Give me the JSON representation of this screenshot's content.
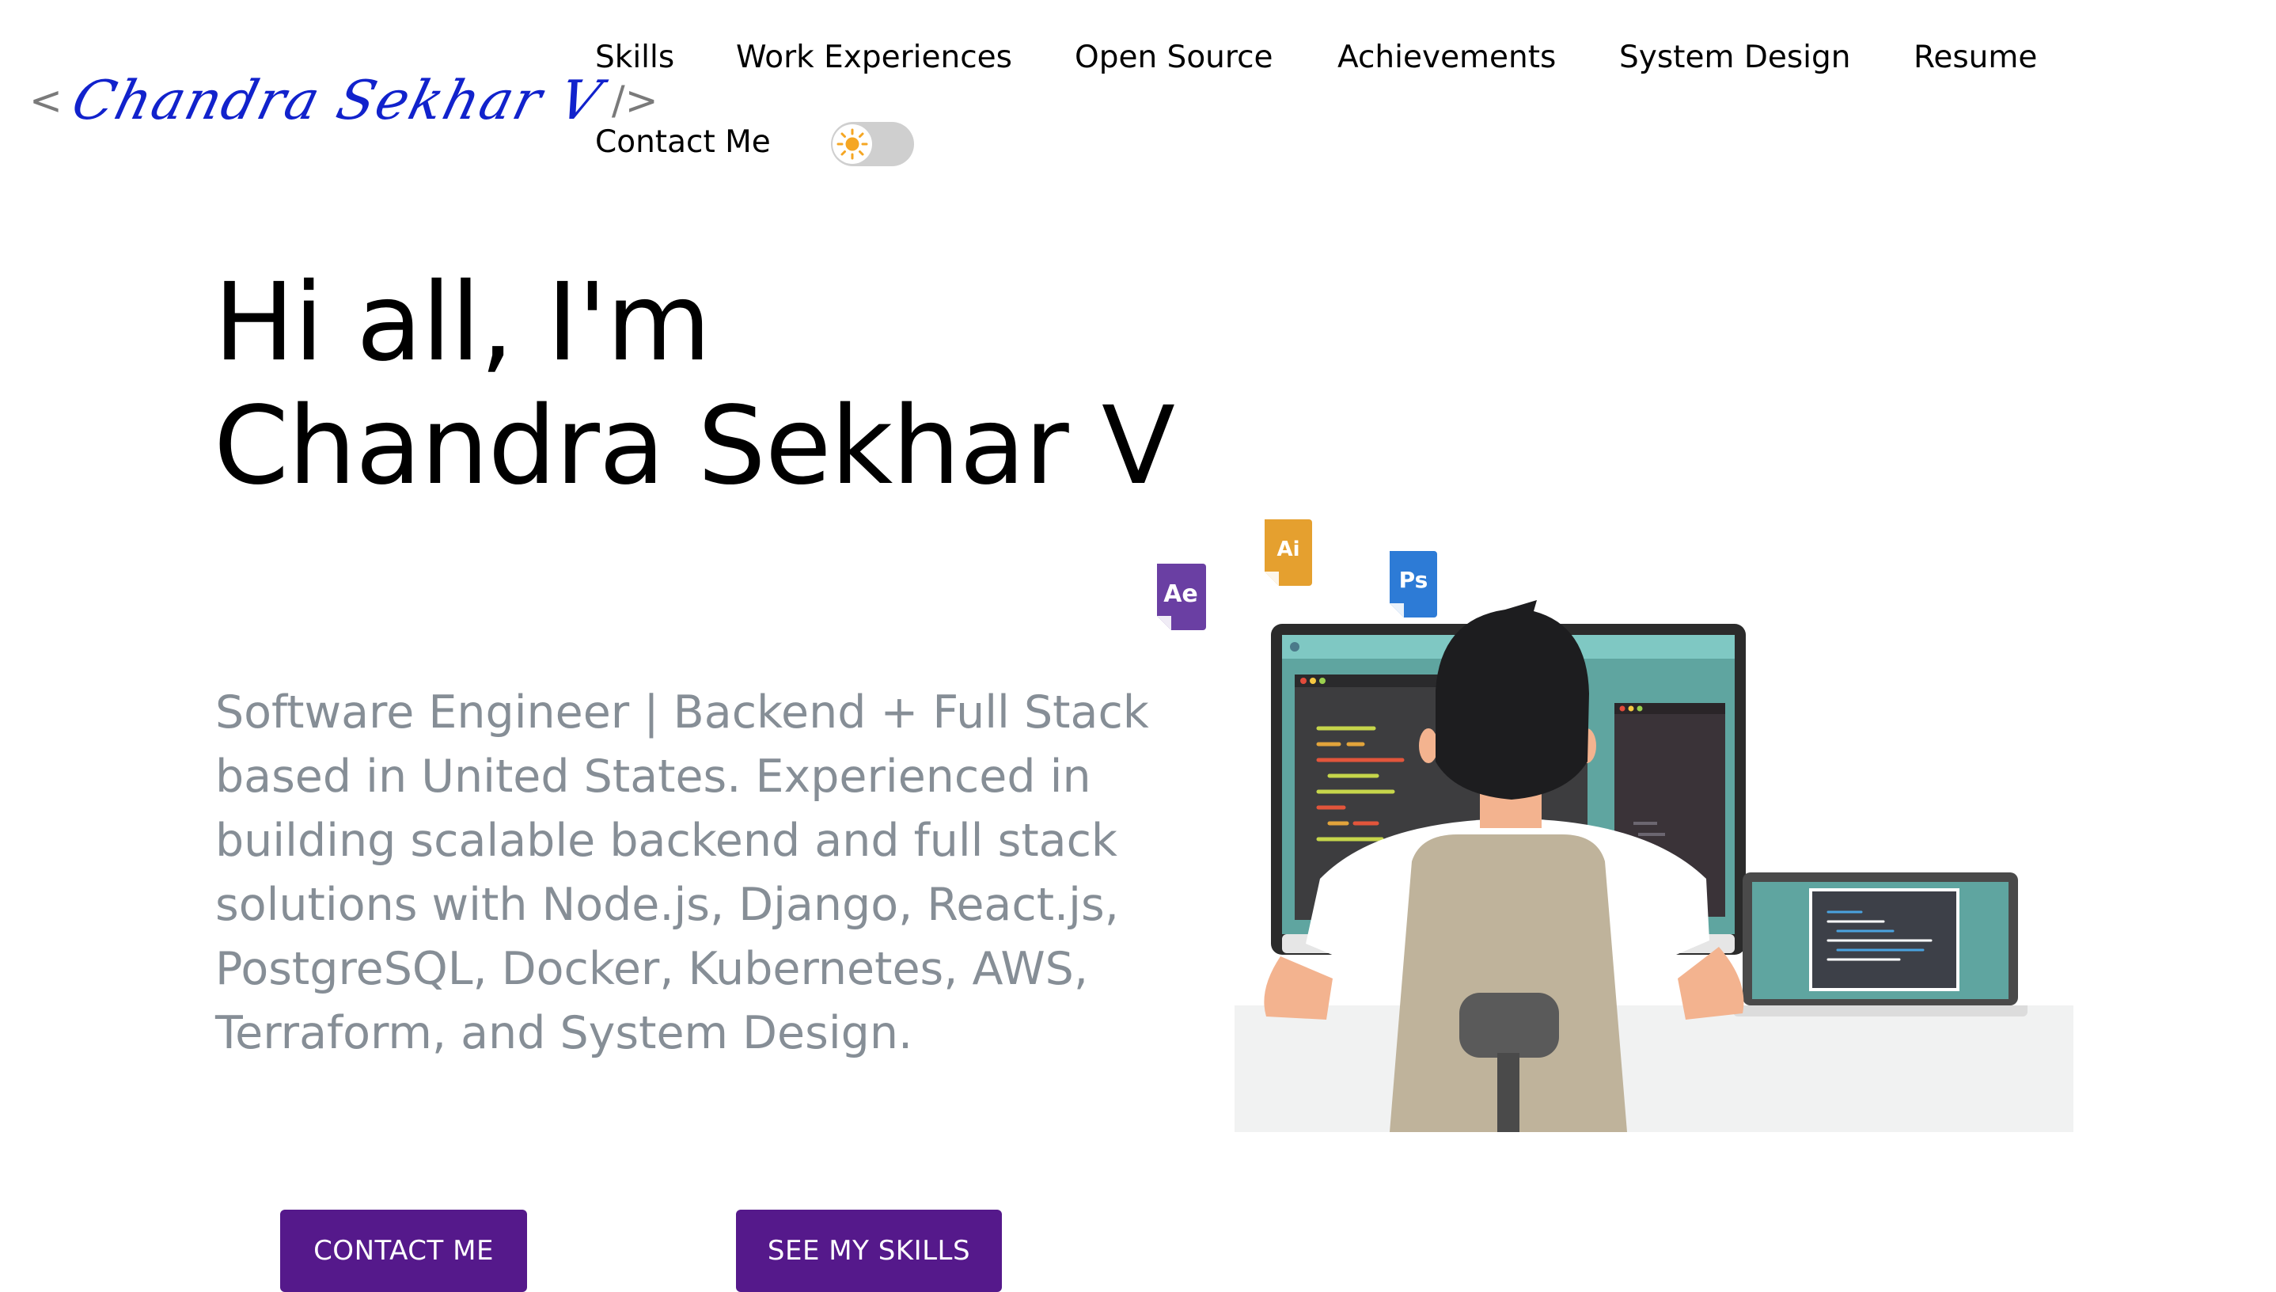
{
  "header": {
    "logo_open": "<",
    "logo_signature": "Chandra Sekhar V",
    "logo_close": "/>",
    "nav": [
      "Skills",
      "Work Experiences",
      "Open Source",
      "Achievements",
      "System Design",
      "Resume",
      "Contact Me"
    ],
    "theme_toggle_icon": "sun-icon"
  },
  "hero": {
    "greeting": "Hi all, I'm Chandra Sekhar V",
    "subtitle": "Software Engineer | Backend + Full Stack based in United States. Experienced in building scalable backend and full stack solutions with Node.js, Django, React.js, PostgreSQL, Docker, Kubernetes, AWS, Terraform, and System Design.",
    "contact_button": "CONTACT ME",
    "skills_button": "SEE MY SKILLS"
  },
  "illustration": {
    "badges": [
      "Ae",
      "Ai",
      "Ps"
    ]
  },
  "colors": {
    "accent": "#55198b",
    "signature": "#1122cc",
    "subtitle_text": "#868e96",
    "toggle_track": "#cfcfcf",
    "sun": "#f5a623"
  }
}
